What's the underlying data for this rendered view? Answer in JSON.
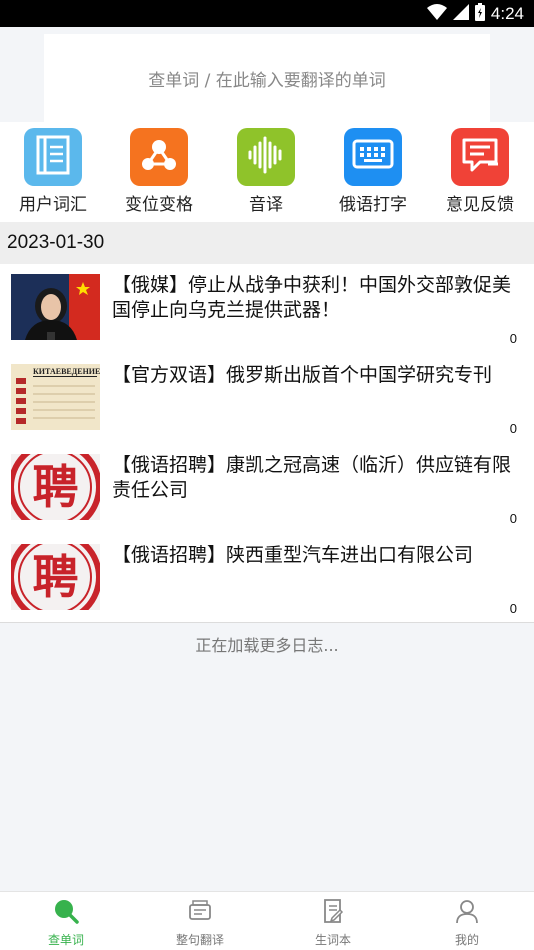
{
  "status_bar": {
    "time": "4:24"
  },
  "search": {
    "placeholder": "查单词 / 在此输入要翻译的单词"
  },
  "shortcuts": [
    {
      "label": "用户词汇",
      "icon": "notebook-icon",
      "color": "#5bb8ec"
    },
    {
      "label": "变位变格",
      "icon": "share-nodes-icon",
      "color": "#f5731f"
    },
    {
      "label": "音译",
      "icon": "sound-wave-icon",
      "color": "#8fc32a"
    },
    {
      "label": "俄语打字",
      "icon": "keyboard-icon",
      "color": "#1e8ff2"
    },
    {
      "label": "意见反馈",
      "icon": "feedback-icon",
      "color": "#f04237"
    }
  ],
  "date": "2023-01-30",
  "news": [
    {
      "title": "【俄媒】停止从战争中获利！中国外交部敦促美国停止向乌克兰提供武器！",
      "count": "0"
    },
    {
      "title": "【官方双语】俄罗斯出版首个中国学研究专刊",
      "count": "0"
    },
    {
      "title": "【俄语招聘】康凯之冠高速（临沂）供应链有限责任公司",
      "count": "0"
    },
    {
      "title": "【俄语招聘】陕西重型汽车进出口有限公司",
      "count": "0"
    }
  ],
  "thumbs": {
    "book_caption": "КИТАЕВЕДЕНИЕ",
    "recruit_glyph": "聘"
  },
  "loading_text": "正在加载更多日志...",
  "tabs": [
    {
      "label": "查单词",
      "icon": "search-icon",
      "active": true
    },
    {
      "label": "整句翻译",
      "icon": "translate-icon",
      "active": false
    },
    {
      "label": "生词本",
      "icon": "vocab-book-icon",
      "active": false
    },
    {
      "label": "我的",
      "icon": "user-icon",
      "active": false
    }
  ],
  "colors": {
    "accent": "#37b24d",
    "recruit_red": "#c8232a"
  }
}
